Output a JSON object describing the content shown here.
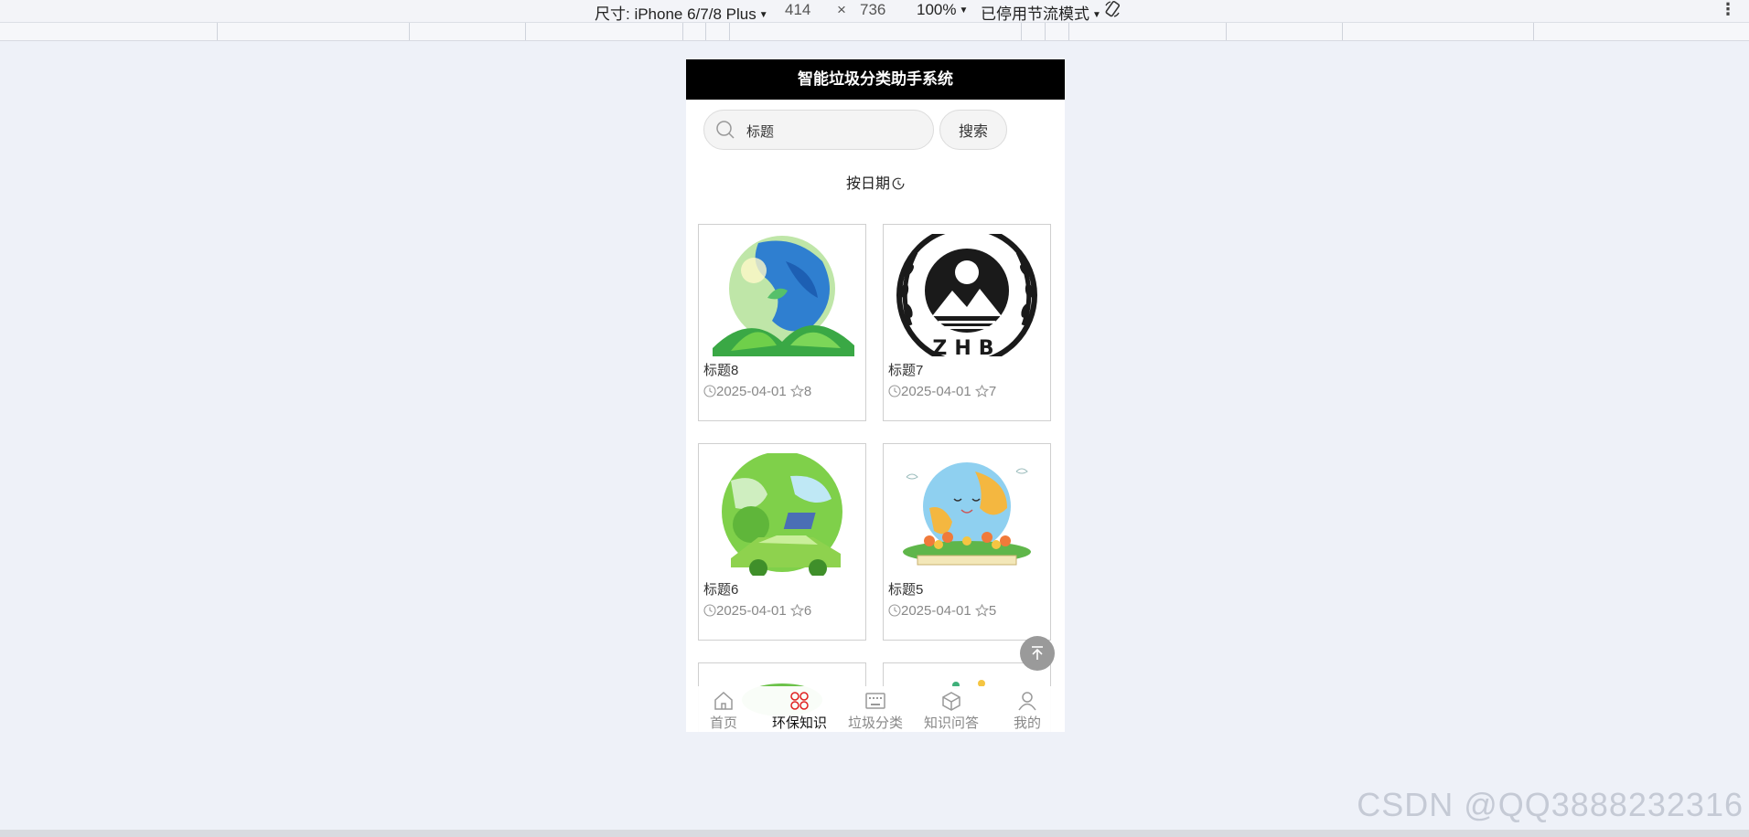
{
  "devtools": {
    "dimensions_label": "尺寸: iPhone 6/7/8 Plus",
    "width": "414",
    "times": "×",
    "height": "736",
    "zoom": "100%",
    "throttle": "已停用节流模式",
    "rotate_icon": "rotate-icon",
    "more_icon": "kebab-icon"
  },
  "app": {
    "title": "智能垃圾分类助手系统",
    "search": {
      "value": "标题",
      "button": "搜索"
    },
    "sort_label": "按日期",
    "cards": [
      {
        "title": "标题8",
        "date": "2025-04-01",
        "stars": "8",
        "image": "green-earth-leaves"
      },
      {
        "title": "标题7",
        "date": "2025-04-01",
        "stars": "7",
        "image": "zhb-emblem"
      },
      {
        "title": "标题6",
        "date": "2025-04-01",
        "stars": "6",
        "image": "green-earth-car"
      },
      {
        "title": "标题5",
        "date": "2025-04-01",
        "stars": "5",
        "image": "smiling-earth-flowers"
      }
    ],
    "tabs": [
      {
        "label": "首页",
        "icon": "home-icon"
      },
      {
        "label": "环保知识",
        "icon": "clover-icon",
        "active": true
      },
      {
        "label": "垃圾分类",
        "icon": "keyboard-icon"
      },
      {
        "label": "知识问答",
        "icon": "cube-icon"
      },
      {
        "label": "我的",
        "icon": "user-icon"
      }
    ]
  },
  "watermark": "CSDN @QQ3888232316",
  "colors": {
    "page_bg": "#eef1f8",
    "header_bg": "#000000",
    "active_tab_icon": "#e02020",
    "back_top": "#9a9a9a"
  }
}
